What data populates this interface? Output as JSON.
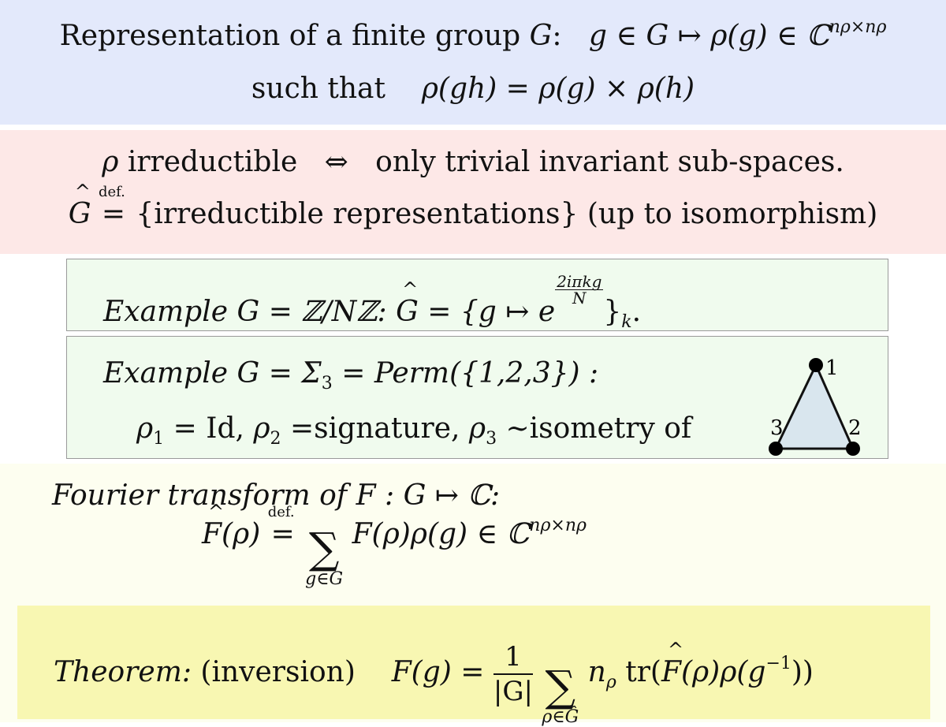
{
  "colors": {
    "definition_band": "#e3e9fb",
    "irreducible_band": "#fde8e7",
    "example_box": "#f0fbee",
    "fourier_band": "#fdfef0",
    "theorem_band": "#f8f7b2",
    "triangle_fill": "#d9e6ee"
  },
  "definition": {
    "line1_text": "Representation of a finite group ",
    "line1_G": "G",
    "line1_colon": ":",
    "line1_map": "g ∈ G ↦ ρ(g) ∈ ℂ",
    "line1_exp": "nρ×nρ",
    "line2_text": "such that",
    "line2_math": "ρ(gh) = ρ(g) × ρ(h)"
  },
  "irreducible": {
    "line1_rho": "ρ",
    "line1_text": " irreductible",
    "line1_iff": "⇔",
    "line1_rest": "only trivial invariant sub-spaces.",
    "line2_G": "G",
    "line2_def": "def.",
    "line2_eq": "=",
    "line2_rest": "{irreductible representations} (up to isomorphism)"
  },
  "example1": {
    "label": "Example",
    "math": " G = ℤ/Nℤ: ",
    "hatG": "G",
    "set_open": " = {g ↦ e",
    "exp_num": "2iπkg",
    "exp_den": "N",
    "set_close": "}",
    "set_sub": "k",
    "end": "."
  },
  "example2": {
    "label": "Example",
    "line1_math": " G = Σ",
    "sigma_sub": "3",
    "line1_rest": " = Perm({1,2,3}) :",
    "line2": [
      {
        "sym": "ρ",
        "sub": "1",
        "text": " = Id, "
      },
      {
        "sym": "ρ",
        "sub": "2",
        "text": " =signature, "
      },
      {
        "sym": "ρ",
        "sub": "3",
        "text": " ∼isometry of"
      }
    ],
    "triangle_labels": [
      "1",
      "2",
      "3"
    ]
  },
  "fourier": {
    "line1_text": "Fourier transform of F : G ↦ ℂ:",
    "lhs_F": "F",
    "lhs_arg": "(ρ)",
    "def": "def.",
    "eq": "=",
    "sum_sym": "∑",
    "sum_lim": "g∈G",
    "rhs": "F(ρ)ρ(g) ∈ ℂ",
    "rhs_exp": "nρ×nρ"
  },
  "theorem": {
    "label": "Theorem:",
    "paren": "(inversion)",
    "lhs": "F(g) = ",
    "frac_num": "1",
    "frac_den": "|G|",
    "sum_sym": "∑",
    "sum_lim": "ρ∈Ĝ",
    "n": "n",
    "n_sub": "ρ",
    "tr": " tr(",
    "F": "F",
    "rest": "(ρ)ρ(g",
    "inv": "−1",
    "close": "))"
  }
}
